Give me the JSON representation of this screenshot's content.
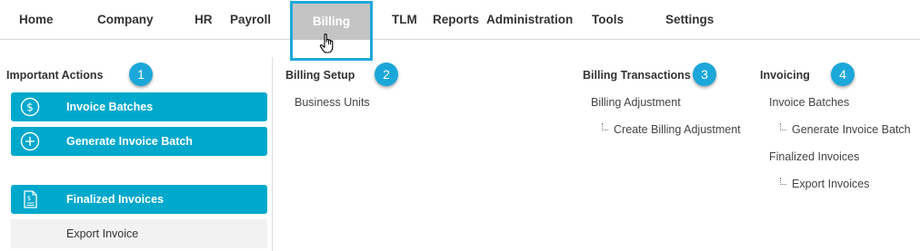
{
  "nav": {
    "home": "Home",
    "company": "Company",
    "hr": "HR",
    "payroll": "Payroll",
    "billing": "Billing",
    "tlm": "TLM",
    "reports": "Reports",
    "administration": "Administration",
    "tools": "Tools",
    "settings": "Settings"
  },
  "important_actions": {
    "title": "Important Actions",
    "badge": "1",
    "buttons": [
      {
        "label": "Invoice Batches",
        "icon": "dollar-circle-icon"
      },
      {
        "label": "Generate Invoice Batch",
        "icon": "plus-circle-icon"
      },
      {
        "label": "Finalized Invoices",
        "icon": "invoice-document-icon"
      }
    ],
    "export": "Export Invoice"
  },
  "billing_setup": {
    "title": "Billing Setup",
    "badge": "2",
    "links": [
      "Business Units"
    ]
  },
  "billing_transactions": {
    "title": "Billing Transactions",
    "badge": "3",
    "links": [
      "Billing Adjustment"
    ],
    "sublinks": [
      "Create Billing Adjustment"
    ]
  },
  "invoicing": {
    "title": "Invoicing",
    "badge": "4",
    "links": [
      "Invoice Batches",
      "Finalized Invoices"
    ],
    "sublinks": [
      "Generate Invoice Batch",
      "Export Invoices"
    ]
  },
  "colors": {
    "accent": "#00a8cc",
    "badge": "#1ba7d9",
    "highlight_border": "#1ea8da",
    "active_tab": "#c4c4c4"
  }
}
